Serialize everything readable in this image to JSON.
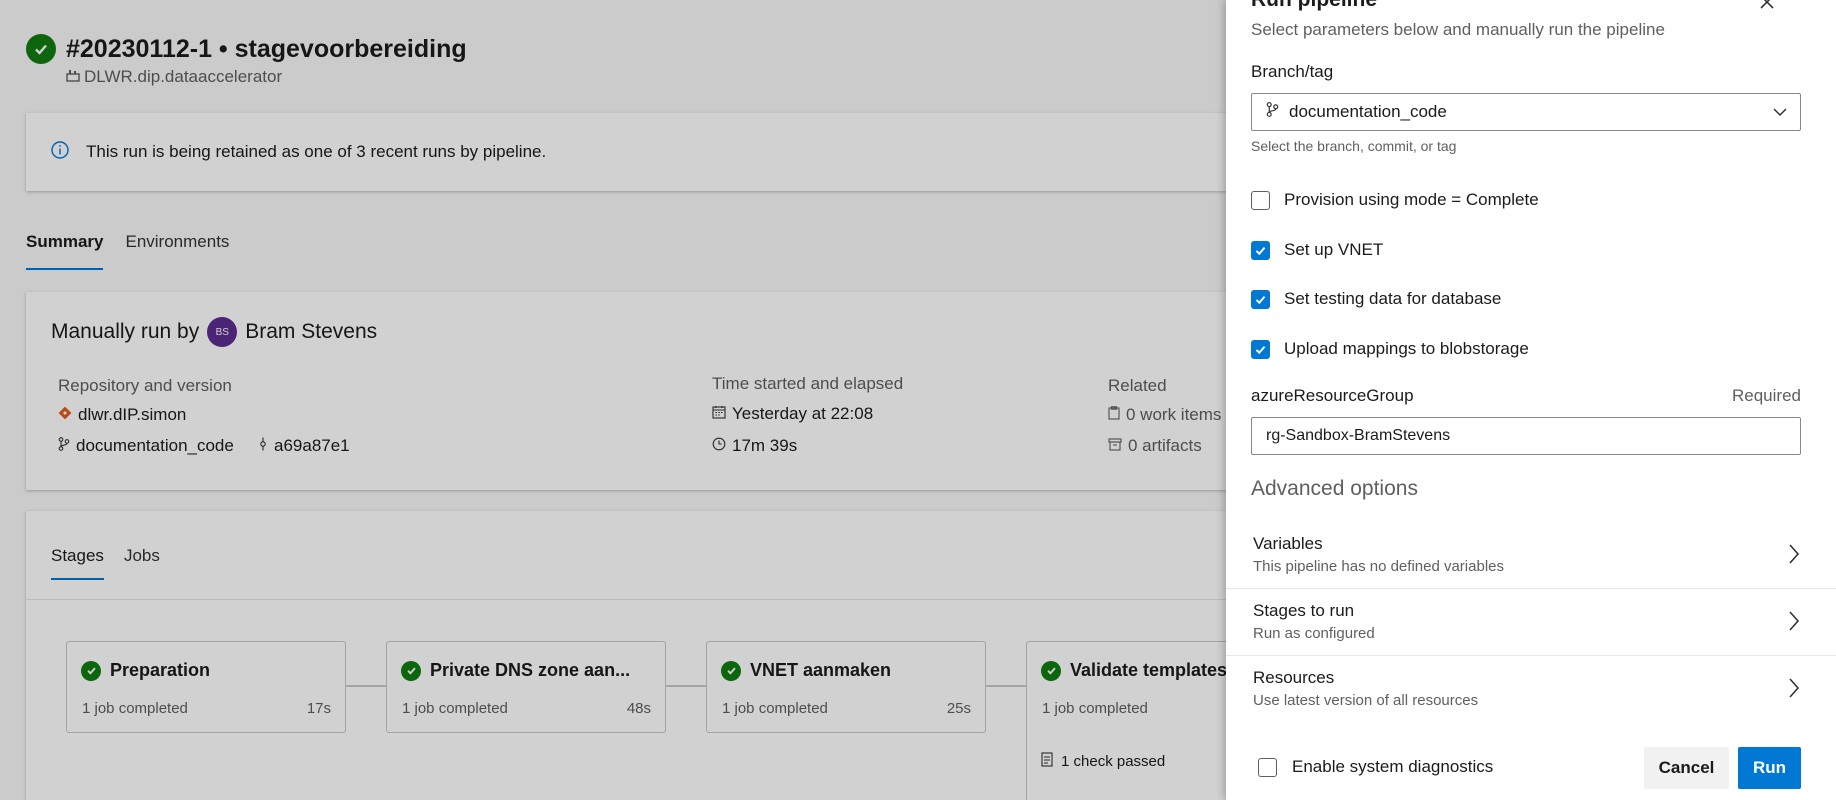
{
  "run": {
    "title": "#20230112-1 • stagevoorbereiding",
    "pipeline": "DLWR.dip.dataaccelerator"
  },
  "banner": {
    "text": "This run is being retained as one of 3 recent runs by pipeline."
  },
  "tabs": [
    "Summary",
    "Environments"
  ],
  "summary": {
    "manual_prefix": "Manually run by",
    "avatar_initials": "BS",
    "user": "Bram Stevens",
    "repo_heading": "Repository and version",
    "repo": "dlwr.dIP.simon",
    "branch": "documentation_code",
    "commit": "a69a87e1",
    "time_heading": "Time started and elapsed",
    "started": "Yesterday at 22:08",
    "elapsed": "17m 39s",
    "related_heading": "Related",
    "work_items": "0 work items",
    "artifacts": "0 artifacts"
  },
  "stage_tabs": [
    "Stages",
    "Jobs"
  ],
  "stages": [
    {
      "name": "Preparation",
      "jobs": "1 job completed",
      "time": "17s"
    },
    {
      "name": "Private DNS zone aan...",
      "jobs": "1 job completed",
      "time": "48s"
    },
    {
      "name": "VNET aanmaken",
      "jobs": "1 job completed",
      "time": "25s"
    },
    {
      "name": "Validate templates",
      "jobs": "1 job completed",
      "time": "",
      "check": "1 check passed"
    }
  ],
  "panel": {
    "title": "Run pipeline",
    "subtitle": "Select parameters below and manually run the pipeline",
    "branch_label": "Branch/tag",
    "branch_value": "documentation_code",
    "branch_hint": "Select the branch, commit, or tag",
    "checkboxes": [
      {
        "label": "Provision using mode = Complete",
        "checked": false
      },
      {
        "label": "Set up VNET",
        "checked": true
      },
      {
        "label": "Set testing data for database",
        "checked": true
      },
      {
        "label": "Upload mappings to blobstorage",
        "checked": true
      }
    ],
    "resource_group_label": "azureResourceGroup",
    "required_label": "Required",
    "resource_group_value": "rg-Sandbox-BramStevens",
    "advanced_heading": "Advanced options",
    "options": [
      {
        "title": "Variables",
        "subtitle": "This pipeline has no defined variables"
      },
      {
        "title": "Stages to run",
        "subtitle": "Run as configured"
      },
      {
        "title": "Resources",
        "subtitle": "Use latest version of all resources"
      }
    ],
    "diagnostics_label": "Enable system diagnostics",
    "diagnostics_checked": false,
    "cancel_label": "Cancel",
    "run_label": "Run"
  },
  "colors": {
    "accent": "#0078d4",
    "success": "#107c10",
    "avatar": "#5c2d91"
  }
}
